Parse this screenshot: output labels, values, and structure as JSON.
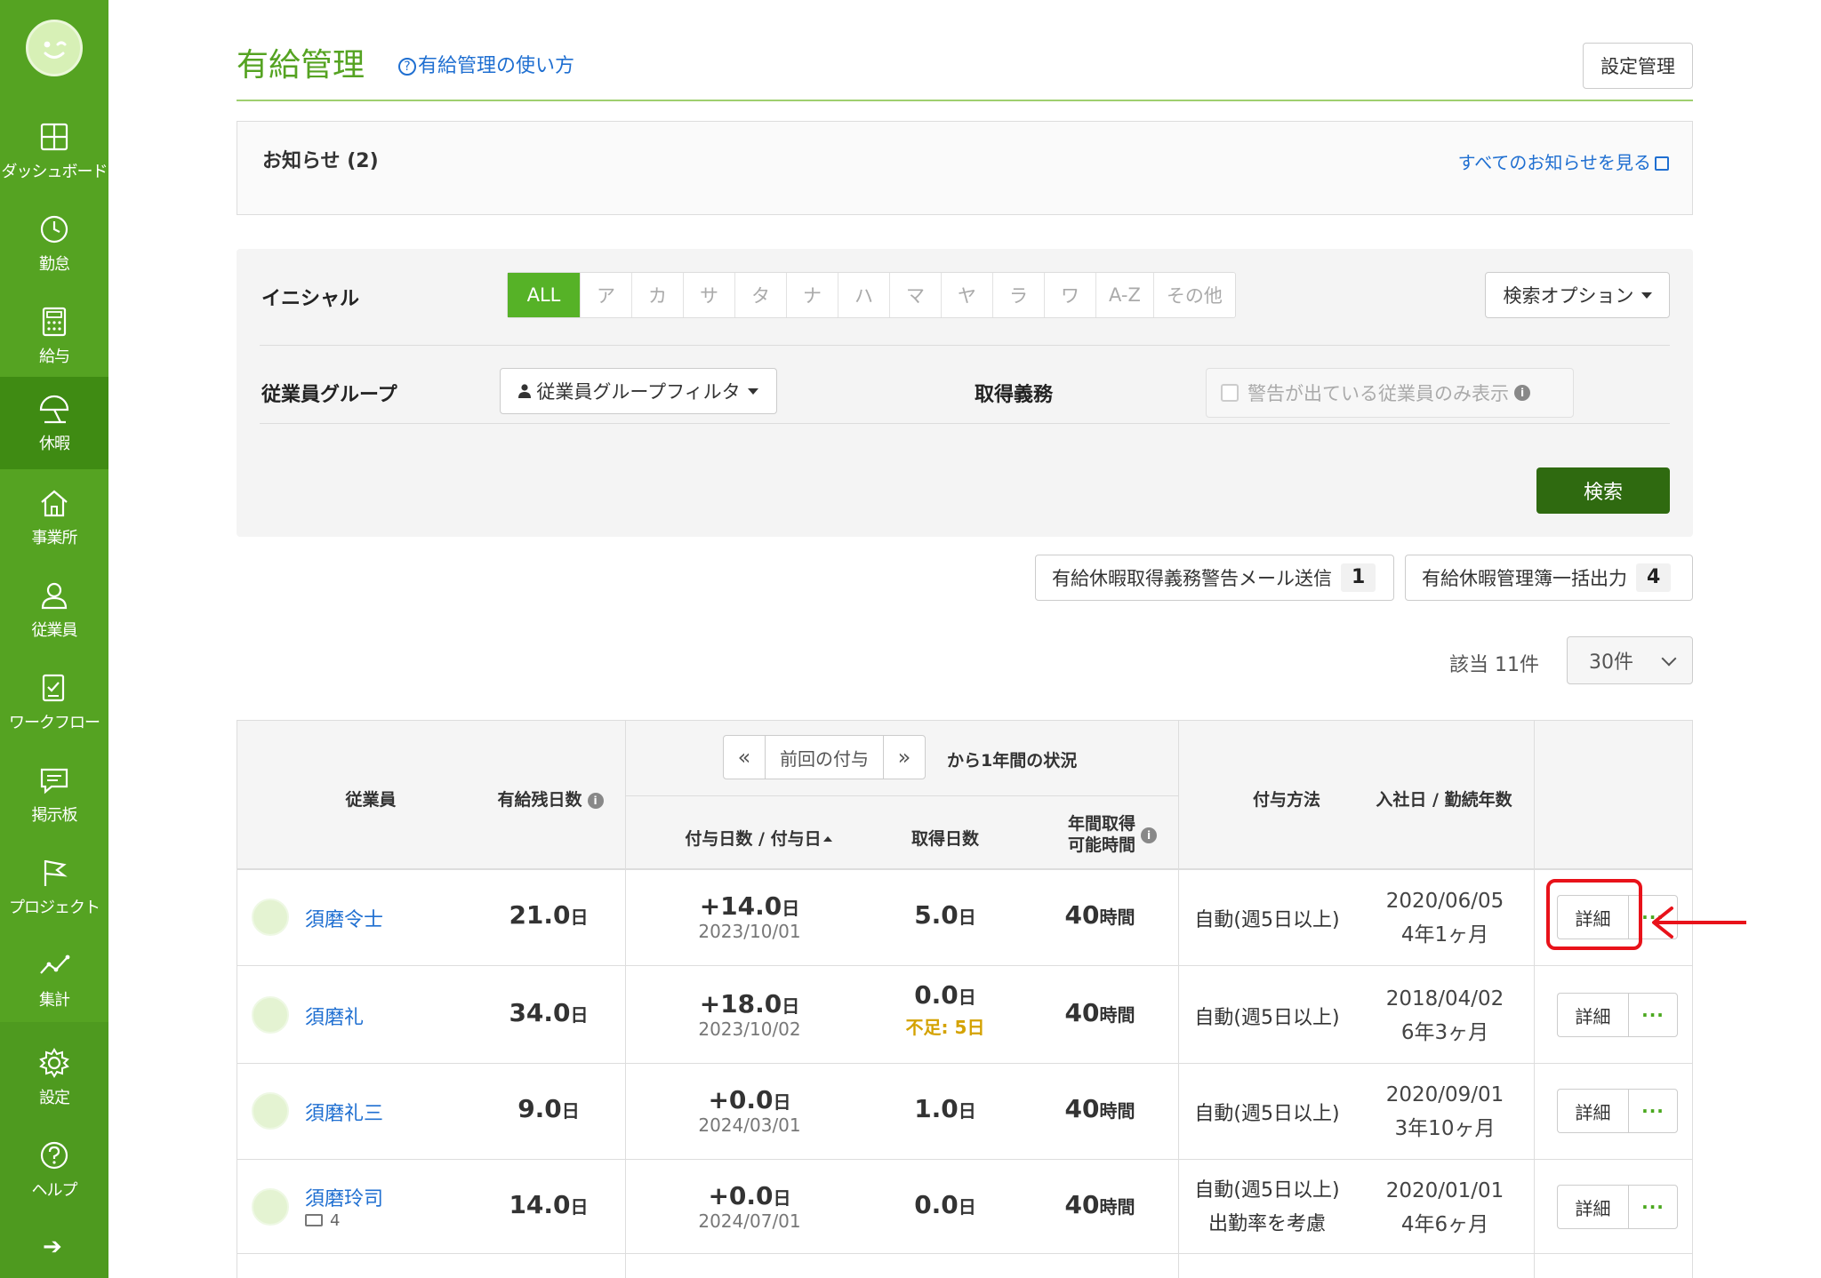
{
  "sidebar": {
    "items": [
      {
        "label": "ダッシュボード",
        "icon": "dashboard-icon"
      },
      {
        "label": "勤怠",
        "icon": "clock-icon"
      },
      {
        "label": "給与",
        "icon": "calculator-icon"
      },
      {
        "label": "休暇",
        "icon": "umbrella-icon",
        "active": true
      },
      {
        "label": "事業所",
        "icon": "house-icon"
      },
      {
        "label": "従業員",
        "icon": "person-icon"
      },
      {
        "label": "ワークフロー",
        "icon": "checklist-icon"
      },
      {
        "label": "掲示板",
        "icon": "chat-icon"
      },
      {
        "label": "プロジェクト",
        "icon": "flag-icon"
      },
      {
        "label": "集計",
        "icon": "line-chart-icon"
      },
      {
        "label": "設定",
        "icon": "gear-icon"
      },
      {
        "label": "ヘルプ",
        "icon": "question-icon"
      }
    ],
    "collapse_glyph": "➔"
  },
  "header": {
    "title": "有給管理",
    "help_link": "有給管理の使い方",
    "settings_button": "設定管理"
  },
  "notices": {
    "title": "お知らせ (2)",
    "view_all": "すべてのお知らせを見る"
  },
  "filters": {
    "initial_label": "イニシャル",
    "initials": [
      "ALL",
      "ア",
      "カ",
      "サ",
      "タ",
      "ナ",
      "ハ",
      "マ",
      "ヤ",
      "ラ",
      "ワ",
      "A-Z",
      "その他"
    ],
    "selected_initial": "ALL",
    "search_options": "検索オプション",
    "group_label": "従業員グループ",
    "group_filter": "従業員グループフィルタ",
    "duty_label": "取得義務",
    "warning_only": "警告が出ている従業員のみ表示",
    "search_button": "検索"
  },
  "actions": {
    "warning_mail": {
      "label": "有給休暇取得義務警告メール送信",
      "count": "1"
    },
    "bulk_export": {
      "label": "有給休暇管理簿一括出力",
      "count": "4"
    }
  },
  "results": {
    "hits": "該当 11件",
    "per_page": "30件"
  },
  "table": {
    "headers": {
      "employee": "従業員",
      "remaining": "有給残日数",
      "pager_prev": "«",
      "pager_label": "前回の付与",
      "pager_next": "»",
      "period_suffix": "から1年間の状況",
      "grant": "付与日数 / 付与日",
      "taken": "取得日数",
      "annual_hours_line1": "年間取得",
      "annual_hours_line2": "可能時間",
      "method": "付与方法",
      "join": "入社日 / 勤続年数"
    },
    "rows": [
      {
        "name": "須磨令士",
        "sub": "",
        "remaining": "21.0",
        "grant": "+14.0",
        "grant_date": "2023/10/01",
        "taken": "5.0",
        "shortage": "",
        "hours": "40",
        "method1": "自動(週5日以上)",
        "method2": "",
        "join_date": "2020/06/05",
        "tenure": "4年1ヶ月",
        "highlighted": true
      },
      {
        "name": "須磨礼",
        "sub": "",
        "remaining": "34.0",
        "grant": "+18.0",
        "grant_date": "2023/10/02",
        "taken": "0.0",
        "shortage": "不足: 5",
        "hours": "40",
        "method1": "自動(週5日以上)",
        "method2": "",
        "join_date": "2018/04/02",
        "tenure": "6年3ヶ月",
        "highlighted": false
      },
      {
        "name": "須磨礼三",
        "sub": "",
        "remaining": "9.0",
        "grant": "+0.0",
        "grant_date": "2024/03/01",
        "taken": "1.0",
        "shortage": "",
        "hours": "40",
        "method1": "自動(週5日以上)",
        "method2": "",
        "join_date": "2020/09/01",
        "tenure": "3年10ヶ月",
        "highlighted": false
      },
      {
        "name": "須磨玲司",
        "sub": "4",
        "remaining": "14.0",
        "grant": "+0.0",
        "grant_date": "2024/07/01",
        "taken": "0.0",
        "shortage": "",
        "hours": "40",
        "method1": "自動(週5日以上)",
        "method2": "出勤率を考慮",
        "join_date": "2020/01/01",
        "tenure": "4年6ヶ月",
        "highlighted": false
      }
    ],
    "day_unit": "日",
    "hour_unit": "時間",
    "detail_button": "詳細",
    "more_button": "···"
  },
  "colors": {
    "sidebar": "#55a322",
    "sidebar_active": "#3f8b13",
    "accent_green": "#56b227",
    "search_button": "#2f6a10",
    "link": "#1f6fd1",
    "annotation_red": "#e8121a",
    "shortage": "#d4a200"
  }
}
